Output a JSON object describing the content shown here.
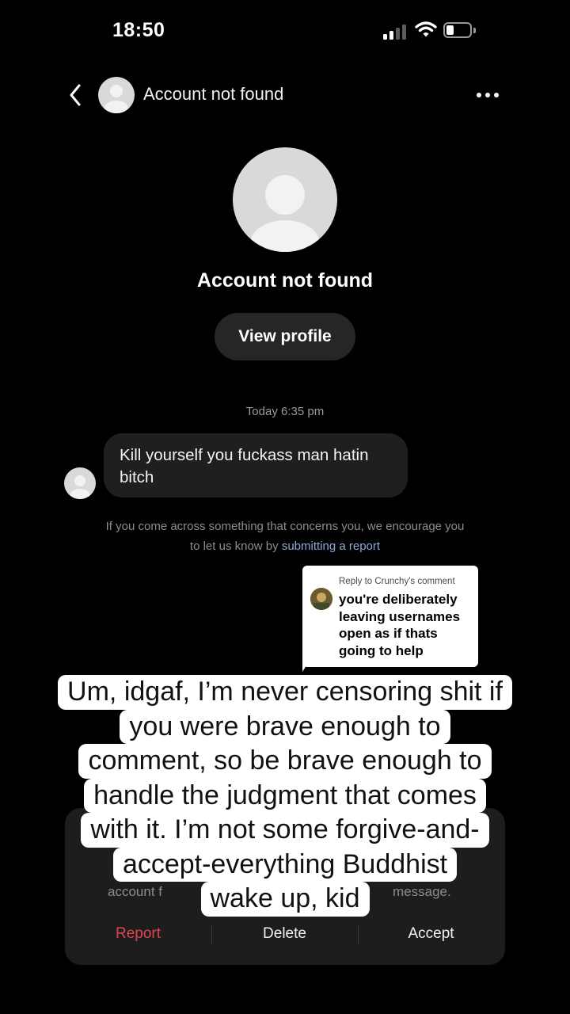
{
  "status_bar": {
    "time": "18:50"
  },
  "header": {
    "title": "Account not found"
  },
  "profile": {
    "name": "Account not found",
    "view_profile_label": "View profile"
  },
  "conversation": {
    "timestamp": "Today 6:35 pm",
    "message": "Kill yourself you fuckass man hatin bitch",
    "notice_text": "If you come across something that concerns you, we encourage you to let us know by ",
    "notice_link": "submitting a report"
  },
  "reply_sticker": {
    "header": "Reply to Crunchy's comment",
    "text": "you're deliberately leaving usernames open as if thats going to help"
  },
  "action_sheet": {
    "partial_left": "account f",
    "partial_right": "message.",
    "report_label": "Report",
    "delete_label": "Delete",
    "accept_label": "Accept"
  },
  "caption": {
    "lines": [
      "Um, idgaf, I’m never censoring shit if",
      "you were brave enough to",
      "comment, so be brave enough to",
      "handle the judgment that comes",
      "with it. I’m not some forgive-and-",
      "accept-everything Buddhist",
      "wake up, kid"
    ]
  },
  "colors": {
    "report": "#e0454f",
    "link": "#8ea8d6",
    "background": "#000000"
  }
}
